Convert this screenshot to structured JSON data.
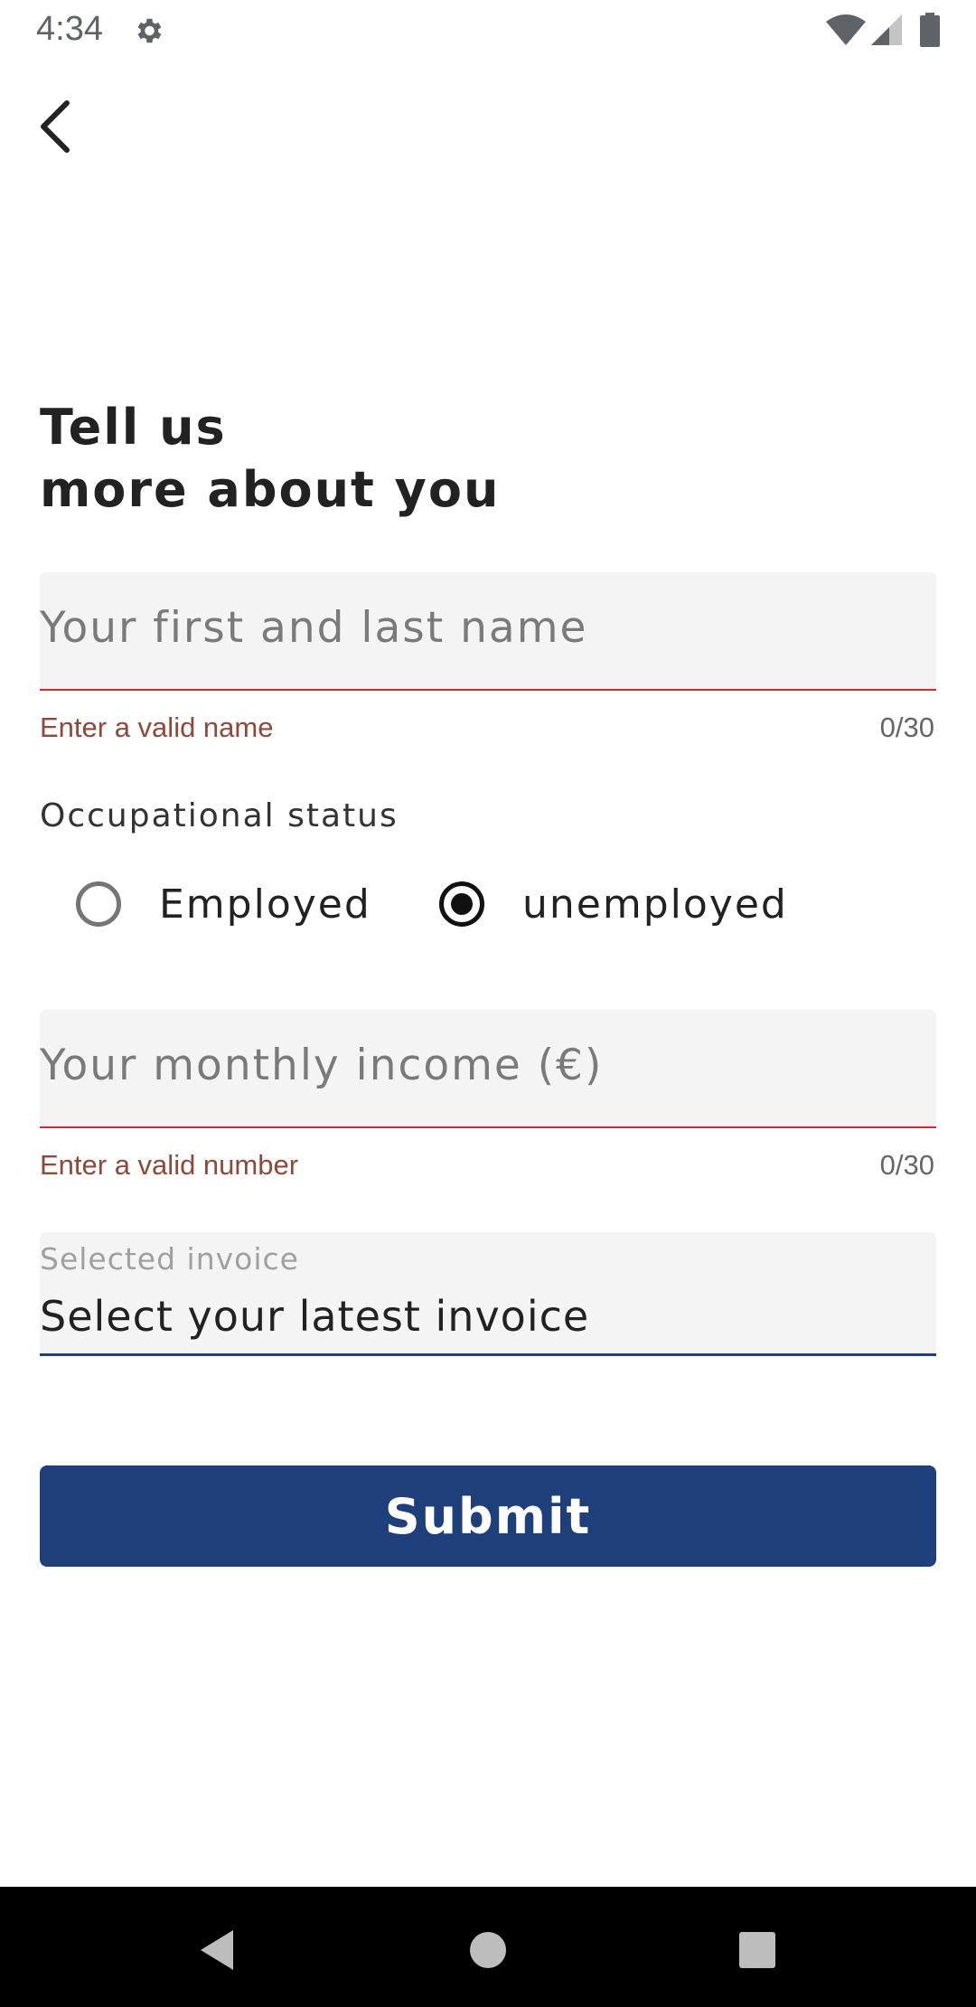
{
  "status_bar": {
    "time": "4:34",
    "icons": [
      "gear-icon",
      "wifi-icon",
      "signal-icon",
      "battery-icon"
    ]
  },
  "header": {
    "back_icon": "chevron-left-icon"
  },
  "title": {
    "line1": "Tell us",
    "line2": "more about you"
  },
  "form": {
    "name_field": {
      "placeholder": "Your first and last name",
      "value": "",
      "error": "Enter a valid name",
      "counter": "0/30"
    },
    "occupation": {
      "label": "Occupational status",
      "options": [
        {
          "label": "Employed",
          "selected": false
        },
        {
          "label": "unemployed",
          "selected": true
        }
      ]
    },
    "income_field": {
      "placeholder": "Your monthly income (€)",
      "value": "",
      "error": "Enter a valid number",
      "counter": "0/30"
    },
    "invoice_field": {
      "label": "Selected invoice",
      "value": "Select your latest invoice"
    },
    "submit_label": "Submit"
  },
  "colors": {
    "primary": "#1f3f7a",
    "error_line": "#c9302c",
    "error_text": "#8b4a3c",
    "field_bg": "#f4f4f4"
  },
  "nav_bar": {
    "icons": [
      "nav-back-icon",
      "nav-home-icon",
      "nav-recents-icon"
    ]
  }
}
